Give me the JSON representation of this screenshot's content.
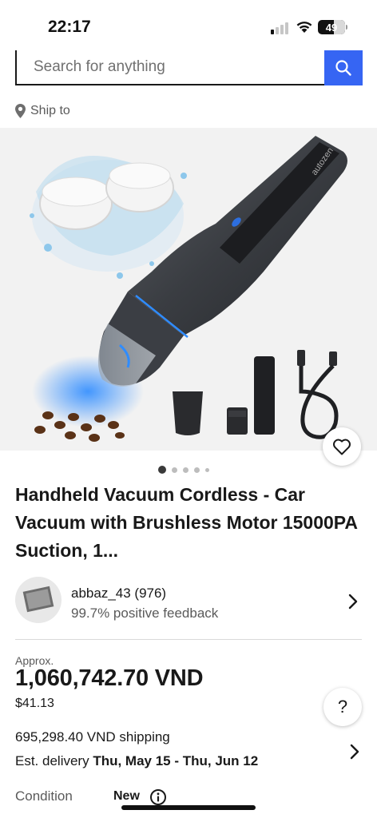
{
  "status_bar": {
    "time": "22:17",
    "battery": "49"
  },
  "search": {
    "placeholder": "Search for anything"
  },
  "ship_to": {
    "label": "Ship to"
  },
  "gallery": {
    "pages": 5,
    "current": 1
  },
  "product": {
    "title": "Handheld Vacuum Cordless - Car Vacuum with Brushless Motor 15000PA Suction, 1...",
    "brand_on_device": "autozen"
  },
  "seller": {
    "name": "abbaz_43 (976)",
    "feedback": "99.7% positive feedback"
  },
  "price": {
    "approx_label": "Approx.",
    "amount": "1,060,742.70 VND",
    "usd": "$41.13"
  },
  "shipping": {
    "cost": "695,298.40 VND shipping",
    "delivery_prefix": "Est. delivery ",
    "delivery_dates": "Thu, May 15 - Thu, Jun 12"
  },
  "condition": {
    "label": "Condition",
    "value": "New"
  },
  "colors": {
    "accent": "#3665f3",
    "text": "#191919",
    "muted": "#5a5a5a"
  },
  "icons": [
    "search-icon",
    "location-pin-icon",
    "heart-icon",
    "chevron-right-icon",
    "help-icon",
    "info-icon"
  ]
}
